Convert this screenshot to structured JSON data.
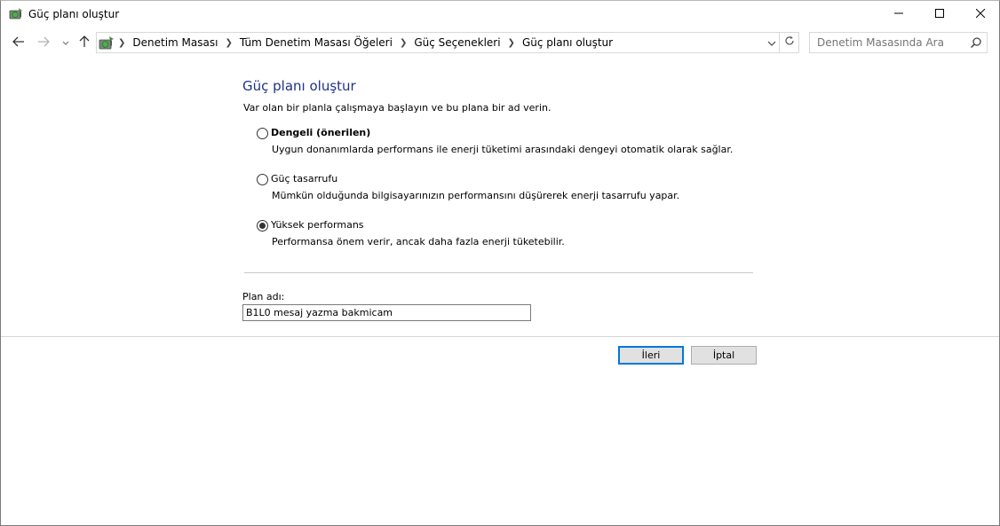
{
  "window": {
    "title": "Güç planı oluştur",
    "icon": "power-options-icon"
  },
  "address": {
    "breadcrumbs": [
      "Denetim Masası",
      "Tüm Denetim Masası Öğeleri",
      "Güç Seçenekleri",
      "Güç planı oluştur"
    ],
    "search_placeholder": "Denetim Masasında Ara"
  },
  "page": {
    "title": "Güç planı oluştur",
    "description": "Var olan bir planla çalışmaya başlayın ve bu plana bir ad verin."
  },
  "options": [
    {
      "label": "Dengeli (önerilen)",
      "description": "Uygun donanımlarda performans ile enerji tüketimi arasındaki dengeyi otomatik olarak sağlar.",
      "selected": false
    },
    {
      "label": "Güç tasarrufu",
      "description": "Mümkün olduğunda bilgisayarınızın performansını düşürerek enerji tasarrufu yapar.",
      "selected": false
    },
    {
      "label": "Yüksek performans",
      "description": "Performansa önem verir, ancak daha fazla enerji tüketebilir.",
      "selected": true
    }
  ],
  "plan_name": {
    "label": "Plan adı:",
    "value": "B1L0 mesaj yazma bakmicam"
  },
  "buttons": {
    "next": "İleri",
    "cancel": "İptal"
  },
  "colors": {
    "title_blue": "#1e3287",
    "focus_blue": "#0078d7"
  }
}
